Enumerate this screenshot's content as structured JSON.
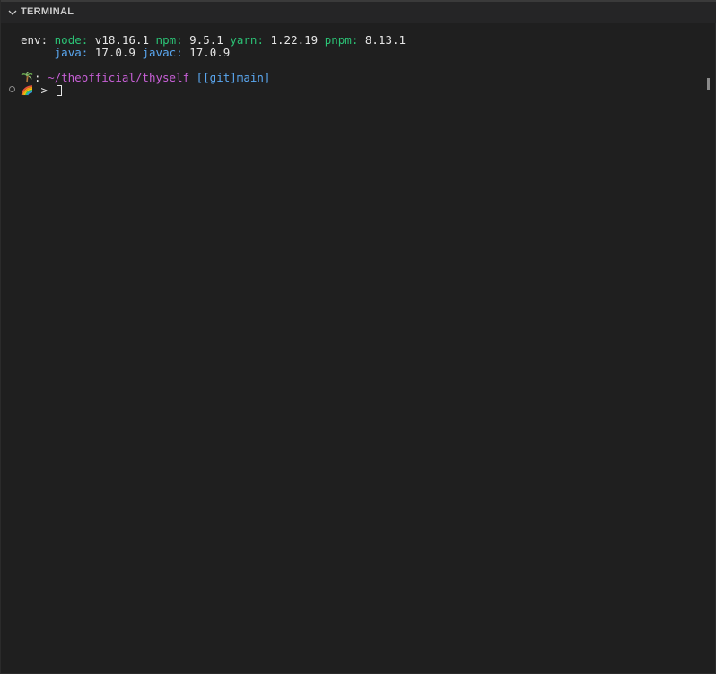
{
  "panel": {
    "title": "TERMINAL",
    "chevron_icon": "chevron-down-icon"
  },
  "terminal": {
    "env_line_1": {
      "prefix": "env: ",
      "node_key": "node:",
      "node_val": " v18.16.1 ",
      "npm_key": "npm:",
      "npm_val": " 9.5.1 ",
      "yarn_key": "yarn:",
      "yarn_val": " 1.22.19 ",
      "pnpm_key": "pnpm:",
      "pnpm_val": " 8.13.1"
    },
    "env_line_2": {
      "indent": "     ",
      "java_key": "java:",
      "java_val": " 17.0.9 ",
      "javac_key": "javac:",
      "javac_val": " 17.0.9"
    },
    "prompt_line": {
      "icon": "palm-tree-icon",
      "colon": ": ",
      "path": "~/theofficial/thyself",
      "git": " [[git]main]"
    },
    "input_line": {
      "icon": "rainbow-icon",
      "caret": " > "
    },
    "colors": {
      "green": "#2bc275",
      "blue": "#5aa7f0",
      "magenta": "#c75fd6",
      "background": "#1f1f1f"
    }
  }
}
